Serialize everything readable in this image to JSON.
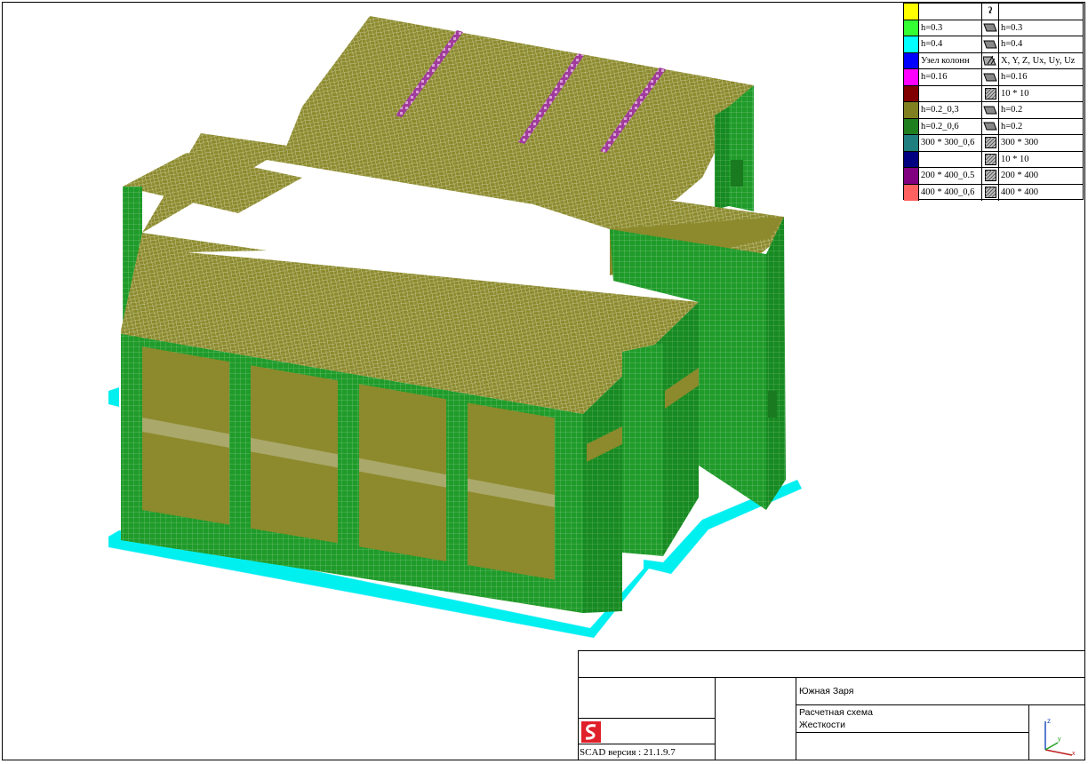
{
  "legend": {
    "header_glyph": "ʔ",
    "rows": [
      {
        "color": "#ffff00",
        "left": "",
        "icon": "",
        "right": ""
      },
      {
        "color": "#33ff33",
        "left": "h=0.3",
        "icon": "plate-icon",
        "right": "h=0.3"
      },
      {
        "color": "#00ffff",
        "left": "h=0.4",
        "icon": "plate-icon",
        "right": "h=0.4"
      },
      {
        "color": "#0000ff",
        "left": "Узел колонн",
        "icon": "constraint-icon",
        "right": "X, Y, Z, Ux, Uy, Uz"
      },
      {
        "color": "#ff00ff",
        "left": "h=0.16",
        "icon": "plate-icon",
        "right": "h=0.16"
      },
      {
        "color": "#800000",
        "left": "",
        "icon": "hatch-icon",
        "right": "10 * 10"
      },
      {
        "color": "#808020",
        "left": "h=0.2_0,3",
        "icon": "plate-icon",
        "right": "h=0.2"
      },
      {
        "color": "#1f7f1f",
        "left": "h=0.2_0,6",
        "icon": "plate-icon",
        "right": "h=0.2"
      },
      {
        "color": "#1f7f7f",
        "left": "300 * 300_0,6",
        "icon": "hatch-icon",
        "right": "300 * 300"
      },
      {
        "color": "#000080",
        "left": "",
        "icon": "hatch-icon",
        "right": "10 * 10"
      },
      {
        "color": "#800080",
        "left": "200 * 400_0.5",
        "icon": "hatch-icon",
        "right": "200 * 400"
      },
      {
        "color": "#ff6060",
        "left": "400 * 400_0,6",
        "icon": "hatch-icon",
        "right": "400 * 400"
      }
    ]
  },
  "title_block": {
    "project": "Южная Заря",
    "subtitle_1": "Расчетная схема",
    "subtitle_2": "Жесткости",
    "version": "SCAD версия : 21.1.9.7"
  },
  "colors": {
    "slab": "#8c8a2c",
    "wall": "#1f9b2a",
    "foundation": "#00f0f0",
    "beam": "#a03c9c",
    "mesh_light": "#c8c896",
    "logo": "#e0202a"
  }
}
